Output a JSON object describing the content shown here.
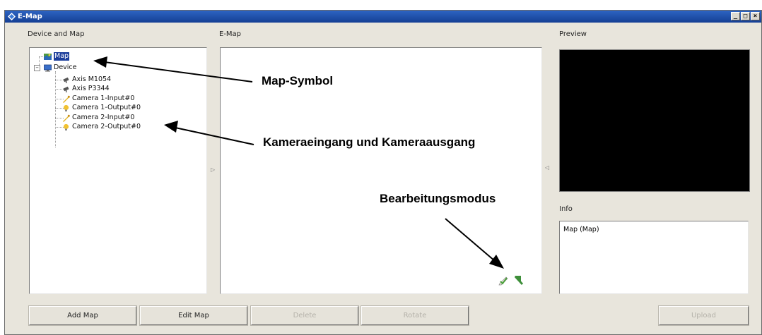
{
  "caption": {
    "bold": "",
    "rest": ""
  },
  "window": {
    "title": "E-Map",
    "controls": {
      "minimize": "_",
      "maximize": "□",
      "close": "×"
    }
  },
  "sections": {
    "device_and_map": "Device and Map",
    "emap": "E-Map",
    "preview": "Preview",
    "info": "Info"
  },
  "tree": {
    "map": "Map",
    "device": "Device",
    "children": [
      {
        "label": "Axis M1054",
        "icon": "camera-icon"
      },
      {
        "label": "Axis P3344",
        "icon": "camera-icon"
      },
      {
        "label": "Camera 1-Input#0",
        "icon": "input-icon"
      },
      {
        "label": "Camera 1-Output#0",
        "icon": "output-bulb-icon"
      },
      {
        "label": "Camera 2-Input#0",
        "icon": "input-icon"
      },
      {
        "label": "Camera 2-Output#0",
        "icon": "output-bulb-icon"
      }
    ]
  },
  "info_text": "Map (Map)",
  "buttons": {
    "add_map": "Add Map",
    "edit_map": "Edit Map",
    "delete": "Delete",
    "rotate": "Rotate",
    "upload": "Upload"
  },
  "annotations": {
    "map_symbol": "Map-Symbol",
    "camera_io": "Kameraeingang und Kameraausgang",
    "edit_mode": "Bearbeitungsmodus"
  },
  "colors": {
    "titlebar": "#1c4aa6",
    "selection": "#1c3e9b",
    "window_bg": "#e8e5dc",
    "preview_bg": "#000000"
  }
}
